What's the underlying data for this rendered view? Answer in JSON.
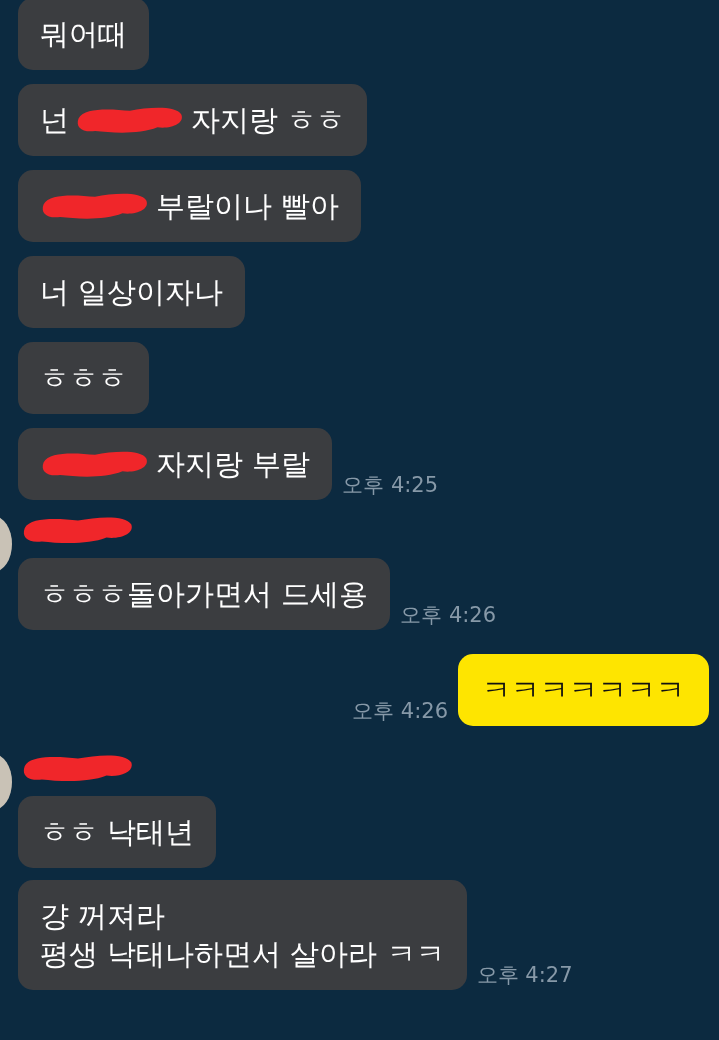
{
  "messages": [
    {
      "kind": "received",
      "parts": [
        {
          "kind": "text",
          "text": "뭐어때"
        }
      ]
    },
    {
      "kind": "received",
      "parts": [
        {
          "kind": "text",
          "text": "넌"
        },
        {
          "kind": "scribble"
        },
        {
          "kind": "text",
          "text": "자지랑 ㅎㅎ"
        }
      ]
    },
    {
      "kind": "received",
      "parts": [
        {
          "kind": "scribble"
        },
        {
          "kind": "text",
          "text": "부랄이나 빨아"
        }
      ]
    },
    {
      "kind": "received",
      "parts": [
        {
          "kind": "text",
          "text": "너 일상이자나"
        }
      ]
    },
    {
      "kind": "received",
      "parts": [
        {
          "kind": "text",
          "text": "ㅎㅎㅎ"
        }
      ]
    },
    {
      "kind": "received",
      "parts": [
        {
          "kind": "scribble"
        },
        {
          "kind": "text",
          "text": "자지랑 부랄"
        }
      ],
      "time": "오후 4:25"
    },
    {
      "kind": "group",
      "messages": [
        {
          "kind": "received",
          "parts": [
            {
              "kind": "text",
              "text": "ㅎㅎㅎ돌아가면서 드세용"
            }
          ],
          "time": "오후 4:26"
        }
      ]
    },
    {
      "kind": "sent",
      "parts": [
        {
          "kind": "text",
          "text": "ㅋㅋㅋㅋㅋㅋㅋ"
        }
      ],
      "time": "오후 4:26"
    },
    {
      "kind": "group",
      "messages": [
        {
          "kind": "received",
          "parts": [
            {
              "kind": "text",
              "text": "ㅎㅎ 낙태년"
            }
          ]
        },
        {
          "kind": "received",
          "parts": [
            {
              "kind": "text",
              "text": "걍 꺼져라\n평생 낙태나하면서 살아라 ㅋㅋ"
            }
          ],
          "time": "오후 4:27"
        }
      ]
    }
  ]
}
